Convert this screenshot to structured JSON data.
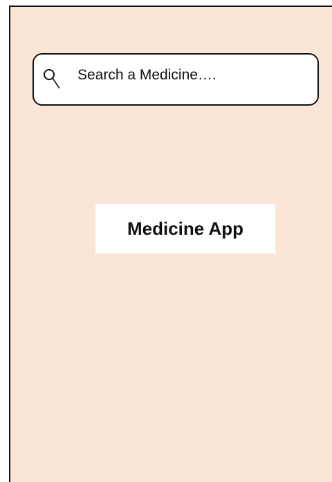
{
  "search": {
    "placeholder": "Search a Medicine….",
    "icon": "search-icon"
  },
  "main": {
    "title": "Medicine App"
  },
  "colors": {
    "background": "#fbe5d6",
    "card": "#ffffff",
    "border": "#111111"
  }
}
